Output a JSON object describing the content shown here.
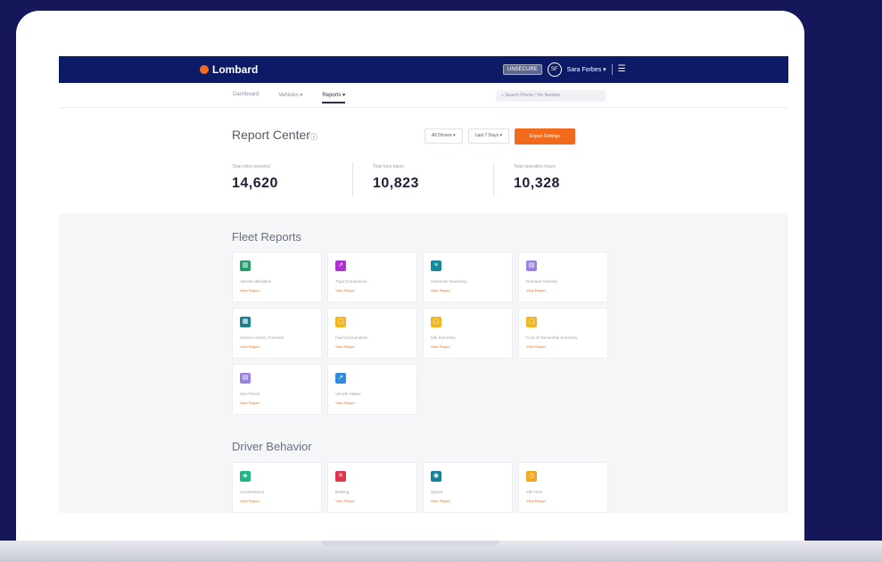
{
  "brand": {
    "name": "Lombard"
  },
  "topbar": {
    "unsecure_label": "UNSECURE",
    "avatar_initials": "SF",
    "user_name": "Sara Forbes"
  },
  "subnav": {
    "tabs": [
      {
        "label": "Dashboard",
        "active": false
      },
      {
        "label": "Vehicles",
        "active": false
      },
      {
        "label": "Reports",
        "active": true
      }
    ],
    "search_placeholder": "Search Phone / Vin Number"
  },
  "report_center": {
    "title": "Report Center",
    "filters": [
      "All Drivers",
      "Last 7 Days"
    ],
    "export_label": "Export Settings"
  },
  "stats": [
    {
      "label": "Total miles traveled",
      "value": "14,620"
    },
    {
      "label": "Total trips taken",
      "value": "10,823"
    },
    {
      "label": "Total operation hours",
      "value": "10,328"
    }
  ],
  "fleet_reports": {
    "title": "Fleet Reports",
    "cards": [
      {
        "name": "Vehicle Utilization",
        "link": "View Report",
        "color": "#2a9d6e",
        "icon": "bar-chart-icon",
        "glyph": "▥"
      },
      {
        "name": "Trips Comparison",
        "link": "View Report",
        "color": "#b22fd6",
        "icon": "trend-icon",
        "glyph": "↗"
      },
      {
        "name": "Odometer Summary",
        "link": "View Report",
        "color": "#168a94",
        "icon": "doc-icon",
        "glyph": "≡"
      },
      {
        "name": "Dormant Vehicles",
        "link": "View Report",
        "color": "#9b82e0",
        "icon": "calendar-icon",
        "glyph": "▤"
      },
      {
        "name": "Service History Forecast",
        "link": "View Report",
        "color": "#1e7f8f",
        "icon": "grid-icon",
        "glyph": "▦"
      },
      {
        "name": "Fuel Consumption",
        "link": "View Report",
        "color": "#f3b61f",
        "icon": "fuel-icon",
        "glyph": "▢"
      },
      {
        "name": "Idle Summary",
        "link": "View Report",
        "color": "#f3b61f",
        "icon": "idle-icon",
        "glyph": "▢"
      },
      {
        "name": "Cost of Ownership Summary",
        "link": "View Report",
        "color": "#f3b61f",
        "icon": "cost-icon",
        "glyph": "▢"
      },
      {
        "name": "Geo Fence",
        "link": "View Report",
        "color": "#9b82e0",
        "icon": "geofence-icon",
        "glyph": "▤"
      },
      {
        "name": "Vehicle Status",
        "link": "View Report",
        "color": "#2f8be0",
        "icon": "status-icon",
        "glyph": "↗"
      }
    ]
  },
  "driver_behavior": {
    "title": "Driver Behavior",
    "cards": [
      {
        "name": "Accelerations",
        "link": "View Report",
        "color": "#22b38a",
        "icon": "acceleration-icon",
        "glyph": "◈"
      },
      {
        "name": "Braking",
        "link": "View Report",
        "color": "#e2334d",
        "icon": "braking-icon",
        "glyph": "✕"
      },
      {
        "name": "Speed",
        "link": "View Report",
        "color": "#17829a",
        "icon": "speed-icon",
        "glyph": "◉"
      },
      {
        "name": "Idle Time",
        "link": "View Report",
        "color": "#f3a71f",
        "icon": "idle-time-icon",
        "glyph": "◷"
      }
    ]
  }
}
